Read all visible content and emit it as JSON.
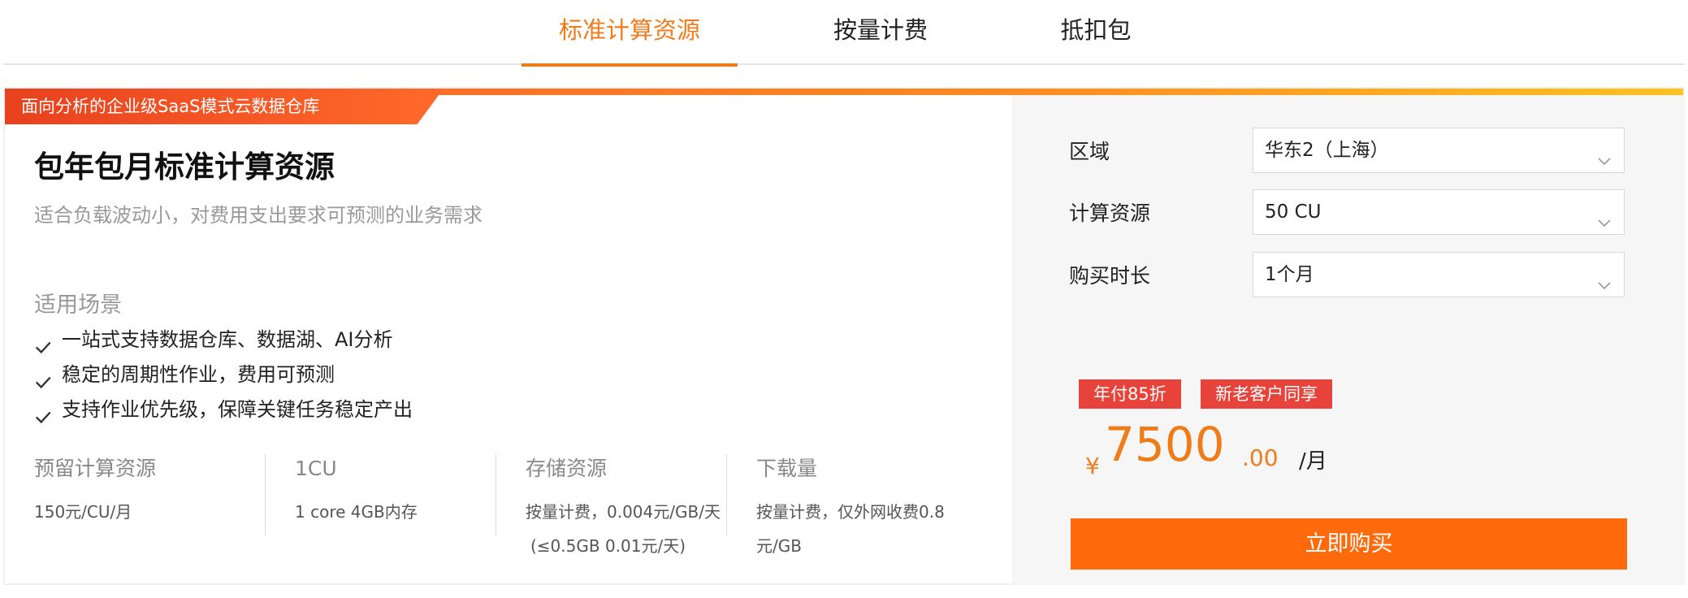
{
  "tabs": [
    {
      "label": "标准计算资源",
      "active": true
    },
    {
      "label": "按量计费",
      "active": false
    },
    {
      "label": "抵扣包",
      "active": false
    }
  ],
  "banner": "面向分析的企业级SaaS模式云数据仓库",
  "product": {
    "title": "包年包月标准计算资源",
    "description": "适合负载波动小，对费用支出要求可预测的业务需求",
    "scenarios_title": "适用场景",
    "scenarios": [
      "一站式支持数据仓库、数据湖、AI分析",
      "稳定的周期性作业，费用可预测",
      "支持作业优先级，保障关键任务稳定产出"
    ]
  },
  "specs": [
    {
      "title": "预留计算资源",
      "lines": [
        "150元/CU/月"
      ]
    },
    {
      "title": "1CU",
      "lines": [
        "1 core 4GB内存"
      ]
    },
    {
      "title": "存储资源",
      "lines": [
        "按量计费，0.004元/GB/天",
        "(≤0.5GB 0.01元/天)"
      ]
    },
    {
      "title": "下载量",
      "lines": [
        "按量计费，仅外网收费0.8",
        "元/GB"
      ]
    }
  ],
  "config": {
    "region": {
      "label": "区域",
      "value": "华东2（上海）"
    },
    "compute": {
      "label": "计算资源",
      "value": "50 CU"
    },
    "duration": {
      "label": "购买时长",
      "value": "1个月"
    }
  },
  "badges": [
    "年付85折",
    "新老客户同享"
  ],
  "price": {
    "currency": "¥",
    "integer": "7500",
    "decimal": ".00",
    "unit": "/月"
  },
  "buy_label": "立即购买",
  "colors": {
    "accent": "#ef7b19",
    "badge": "#e8433a",
    "buy_button": "#ff6b0c"
  }
}
